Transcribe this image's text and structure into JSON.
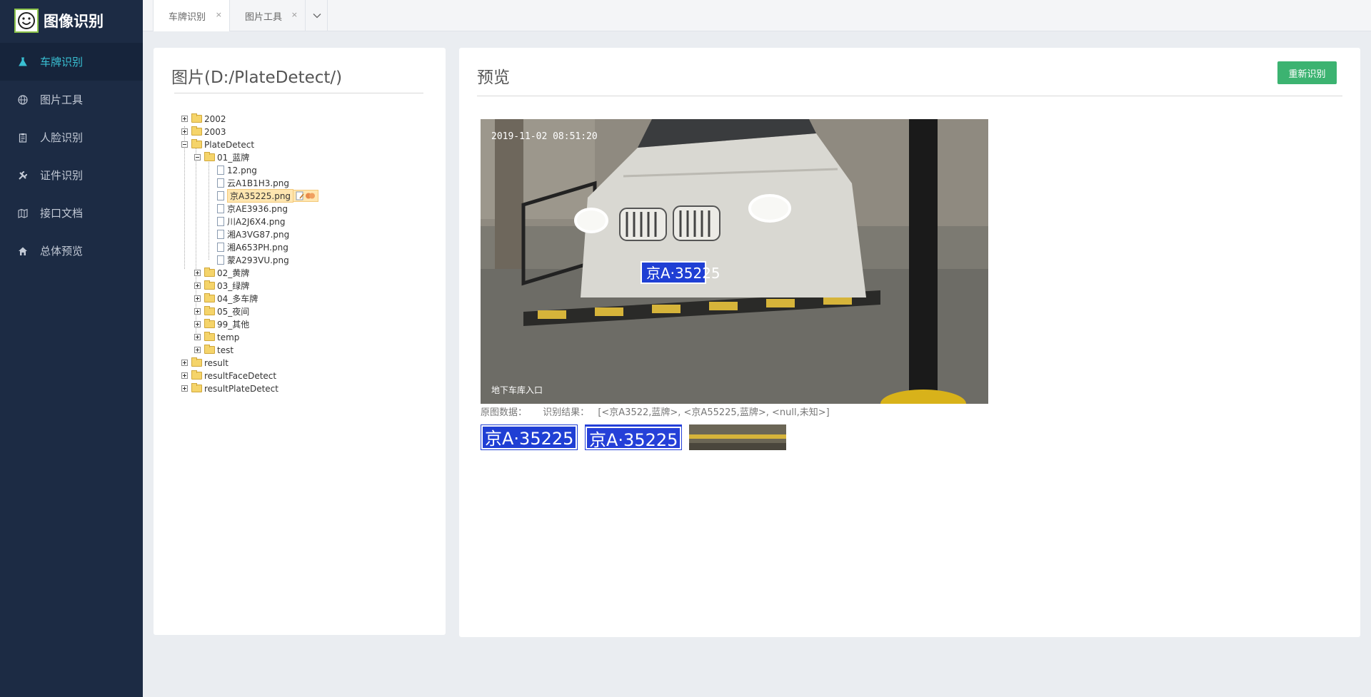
{
  "app": {
    "title": "图像识别"
  },
  "sidebar": {
    "items": [
      {
        "label": "车牌识别",
        "icon": "flask-icon",
        "active": true
      },
      {
        "label": "图片工具",
        "icon": "globe-icon",
        "active": false
      },
      {
        "label": "人脸识别",
        "icon": "clipboard-icon",
        "active": false
      },
      {
        "label": "证件识别",
        "icon": "tools-icon",
        "active": false
      },
      {
        "label": "接口文档",
        "icon": "map-icon",
        "active": false
      },
      {
        "label": "总体预览",
        "icon": "home-icon",
        "active": false
      }
    ]
  },
  "tabs": [
    {
      "label": "车牌识别",
      "close": "×"
    },
    {
      "label": "图片工具",
      "close": "×"
    }
  ],
  "left_panel": {
    "title": "图片(D:/PlateDetect/)",
    "tree": {
      "n2002": "2002",
      "n2003": "2003",
      "plate_detect": "PlateDetect",
      "blue": "01_蓝牌",
      "files": [
        "12.png",
        "云A1B1H3.png",
        "京A35225.png",
        "京AE3936.png",
        "川A2J6X4.png",
        "湘A3VG87.png",
        "湘A653PH.png",
        "蒙A293VU.png"
      ],
      "selected_file": "京A35225.png",
      "sub_folders": [
        "02_黄牌",
        "03_绿牌",
        "04_多车牌",
        "05_夜间",
        "99_其他",
        "temp",
        "test"
      ],
      "root_folders": [
        "result",
        "resultFaceDetect",
        "resultPlateDetect"
      ]
    }
  },
  "right_panel": {
    "title": "预览",
    "redetect_button": "重新识别",
    "photo": {
      "timestamp": "2019-11-02 08:51:20",
      "caption": "地下车库入口",
      "plate_text": "京A·35225"
    },
    "original_label": "原图数据：",
    "result_label": "识别结果：",
    "result_value": "[<京A3522,蓝牌>, <京A55225,蓝牌>, <null,未知>]",
    "thumbs": [
      {
        "text": "京A·35225"
      },
      {
        "text": "京A·35225"
      },
      {
        "text": ""
      }
    ]
  },
  "colors": {
    "sidebar_bg": "#1c2b44",
    "active_text": "#39c0d3",
    "button_green": "#3cb371",
    "plate_blue": "#1f3fd4"
  }
}
